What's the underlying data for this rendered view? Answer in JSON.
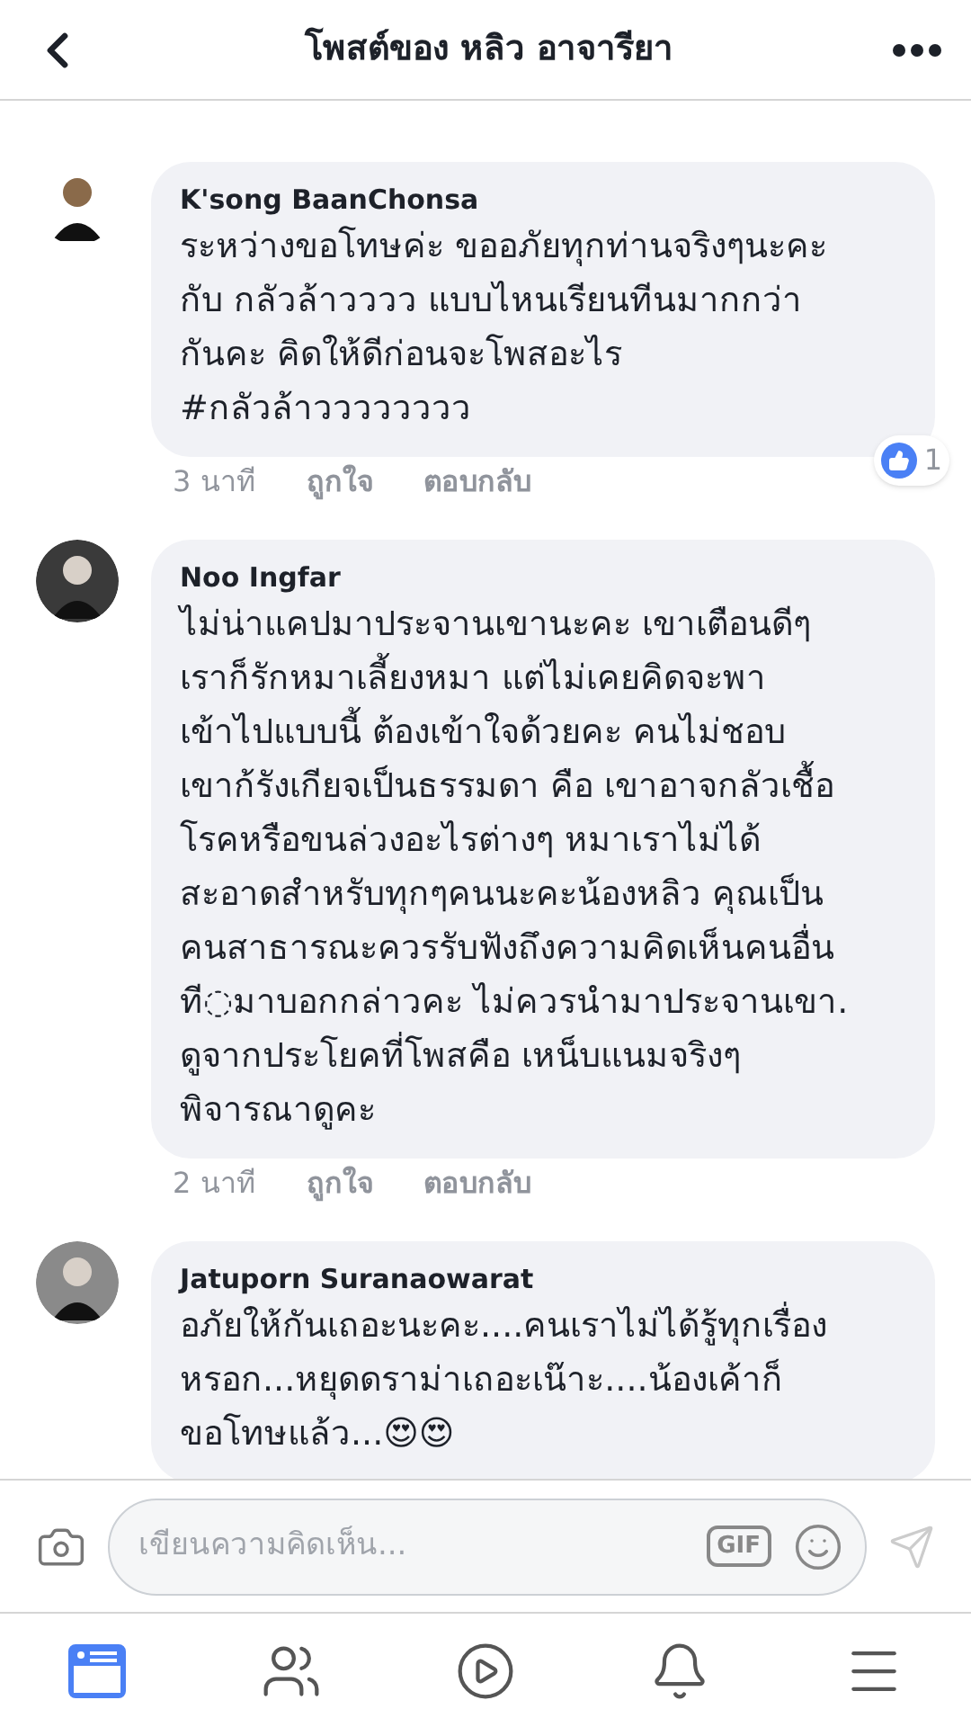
{
  "header": {
    "title": "โพสต์ของ หลิว อาจารียา"
  },
  "comments": [
    {
      "name": "K'song BaanChonsa",
      "text": "ระหว่างขอโทษค่ะ ขออภัยทุกท่านจริงๆนะคะ\nกับ กลัวล้าวววว แบบไหนเรียนทีนมากกว่า\nกันคะ คิดให้ดีก่อนจะโพสอะไร\n#กลัวล้าวววววววว",
      "time": "3 นาที",
      "like": "ถูกใจ",
      "reply": "ตอบกลับ",
      "reactions": "1"
    },
    {
      "name": "Noo Ingfar",
      "text": "ไม่น่าแคปมาประจานเขานะคะ เขาเตือนดีๆ\nเราก็รักหมาเลี้ยงหมา แต่ไม่เคยคิดจะพา\nเข้าไปแบบนี้ ต้องเข้าใจด้วยคะ คนไม่ชอบ\nเขาก้รังเกียจเป็นธรรมดา คือ เขาอาจกลัวเชื้อ\nโรคหรือขนล่วงอะไรต่างๆ หมาเราไม่ได้\nสะอาดสำหรับทุกๆคนนะคะน้องหลิว คุณเป็น\nคนสาธารณะควรรับฟังถึงความคิดเห็นคนอื่น\nที◌มาบอกกล่าวคะ ไม่ควรนำมาประจานเขา.\nดูจากประโยคที่โพสคือ เหน็บแนมจริงๆ\nพิจารณาดูคะ",
      "time": "2 นาที",
      "like": "ถูกใจ",
      "reply": "ตอบกลับ"
    },
    {
      "name": "Jatuporn Suranaowarat",
      "text": "อภัยให้กันเถอะนะคะ....คนเราไม่ได้รู้ทุกเรื่อง\nหรอก...หยุดดราม่าเถอะเน๊าะ....น้องเค้าก็\nขอโทษแล้ว...😍😍"
    }
  ],
  "composer": {
    "placeholder": "เขียนความคิดเห็น...",
    "gif": "GIF"
  },
  "nav": [
    {
      "kind": "feed",
      "selected": true
    },
    {
      "kind": "friends",
      "selected": false
    },
    {
      "kind": "watch",
      "selected": false
    },
    {
      "kind": "bell",
      "selected": false
    },
    {
      "kind": "menu",
      "selected": false
    }
  ]
}
